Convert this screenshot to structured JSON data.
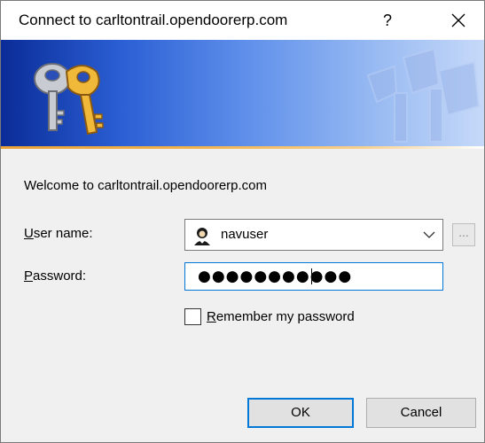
{
  "window": {
    "title": "Connect to carltontrail.opendoorerp.com",
    "help_label": "?",
    "close_icon": "close-icon"
  },
  "banner": {
    "icon": "keys-icon",
    "colors": {
      "banner_dark": "#0a2c98",
      "banner_light": "#c6d9f9",
      "accent_line": "#f0b14c"
    }
  },
  "form": {
    "welcome": "Welcome to carltontrail.opendoorerp.com",
    "username_label_first": "U",
    "username_label_rest": "ser name:",
    "username_value": "navuser",
    "username_icon": "user-icon",
    "browse_label": "...",
    "password_label_first": "P",
    "password_label_rest": "assword:",
    "password_value": "●●●●●●●●●●●",
    "remember_first": "R",
    "remember_rest": "emember my password",
    "remember_checked": false
  },
  "buttons": {
    "ok": "OK",
    "cancel": "Cancel"
  }
}
